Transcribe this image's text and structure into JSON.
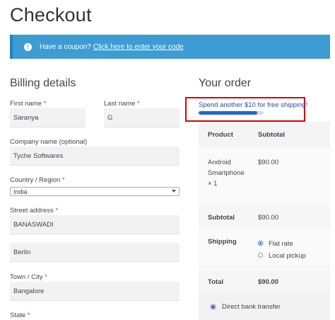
{
  "page": {
    "title": "Checkout"
  },
  "notice": {
    "text": "Have a coupon?",
    "link": "Click here to enter your code"
  },
  "billing": {
    "title": "Billing details",
    "first_name": {
      "label": "First name",
      "value": "Saranya"
    },
    "last_name": {
      "label": "Last name",
      "value": "G"
    },
    "company": {
      "label": "Company name (optional)",
      "value": "Tyche Softwares"
    },
    "country": {
      "label": "Country / Region",
      "value": "India"
    },
    "street": {
      "label": "Street address",
      "line1": "BANASWADI",
      "line2": "Berlin"
    },
    "town": {
      "label": "Town / City",
      "value": "Bangalore"
    },
    "state": {
      "label": "State"
    },
    "required_mark": "*"
  },
  "order": {
    "title": "Your order",
    "shipping_message": "Spend another $10 for free shipping!",
    "shipping_progress": 0.9,
    "headers": {
      "product": "Product",
      "subtotal": "Subtotal"
    },
    "item": {
      "name_line1": "Android",
      "name_line2": "Smartphone",
      "qty": "× 1",
      "price": "$90.00"
    },
    "subtotal": {
      "label": "Subtotal",
      "value": "$90.00"
    },
    "shipping": {
      "label": "Shipping",
      "options": [
        "Flat rate",
        "Local pickup"
      ],
      "selected": "Flat rate"
    },
    "total": {
      "label": "Total",
      "value": "$90.00"
    },
    "payment_method": "Direct bank transfer"
  }
}
